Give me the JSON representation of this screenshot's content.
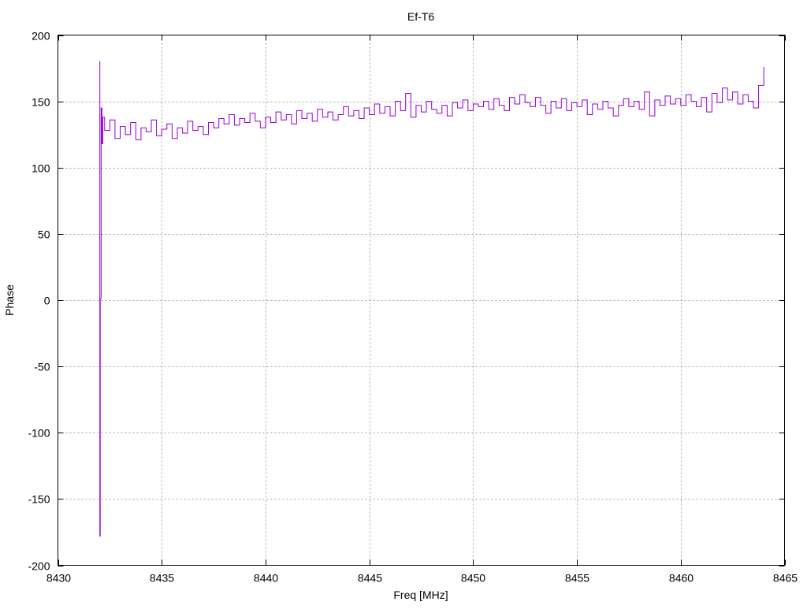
{
  "chart_data": {
    "type": "line",
    "title": "Ef-T6",
    "xlabel": "Freq [MHz]",
    "ylabel": "Phase",
    "xlim": [
      8430,
      8465
    ],
    "ylim": [
      -200,
      200
    ],
    "xticks": [
      8430,
      8435,
      8440,
      8445,
      8450,
      8455,
      8460,
      8465
    ],
    "yticks": [
      -200,
      -150,
      -100,
      -50,
      0,
      50,
      100,
      150,
      200
    ],
    "grid": true,
    "legend": "none",
    "series": [
      {
        "name": "Ef-T6",
        "color": "#9400d3",
        "style": "steps",
        "x": [
          8432.0,
          8432.02,
          8432.04,
          8432.08,
          8432.12,
          8432.16,
          8432.25,
          8432.5,
          8432.75,
          8433,
          8433.25,
          8433.5,
          8433.75,
          8434,
          8434.25,
          8434.5,
          8434.75,
          8435,
          8435.25,
          8435.5,
          8435.75,
          8436,
          8436.25,
          8436.5,
          8436.75,
          8437,
          8437.25,
          8437.5,
          8437.75,
          8438,
          8438.25,
          8438.5,
          8438.75,
          8439,
          8439.25,
          8439.5,
          8439.75,
          8440,
          8440.25,
          8440.5,
          8440.75,
          8441,
          8441.25,
          8441.5,
          8441.75,
          8442,
          8442.25,
          8442.5,
          8442.75,
          8443,
          8443.25,
          8443.5,
          8443.75,
          8444,
          8444.25,
          8444.5,
          8444.75,
          8445,
          8445.25,
          8445.5,
          8445.75,
          8446,
          8446.25,
          8446.5,
          8446.75,
          8447,
          8447.25,
          8447.5,
          8447.75,
          8448,
          8448.25,
          8448.5,
          8448.75,
          8449,
          8449.25,
          8449.5,
          8449.75,
          8450,
          8450.25,
          8450.5,
          8450.75,
          8451,
          8451.25,
          8451.5,
          8451.75,
          8452,
          8452.25,
          8452.5,
          8452.75,
          8453,
          8453.25,
          8453.5,
          8453.75,
          8454,
          8454.25,
          8454.5,
          8454.75,
          8455,
          8455.25,
          8455.5,
          8455.75,
          8456,
          8456.25,
          8456.5,
          8456.75,
          8457,
          8457.25,
          8457.5,
          8457.75,
          8458,
          8458.25,
          8458.5,
          8458.75,
          8459,
          8459.25,
          8459.5,
          8459.75,
          8460,
          8460.25,
          8460.5,
          8460.75,
          8461,
          8461.25,
          8461.5,
          8461.75,
          8462,
          8462.25,
          8462.5,
          8462.75,
          8463,
          8463.25,
          8463.5,
          8463.75,
          8464
        ],
        "y": [
          180,
          -178,
          1,
          145,
          118,
          138,
          128,
          136,
          122,
          131,
          125,
          134,
          121,
          130,
          127,
          136,
          124,
          129,
          133,
          122,
          130,
          126,
          135,
          128,
          131,
          125,
          134,
          130,
          137,
          133,
          140,
          132,
          137,
          134,
          141,
          135,
          130,
          138,
          134,
          142,
          136,
          140,
          133,
          143,
          137,
          141,
          135,
          144,
          138,
          142,
          136,
          140,
          146,
          139,
          143,
          137,
          145,
          140,
          148,
          141,
          146,
          139,
          150,
          143,
          156,
          138,
          147,
          142,
          150,
          144,
          141,
          147,
          139,
          149,
          145,
          151,
          143,
          148,
          146,
          150,
          144,
          152,
          147,
          143,
          153,
          148,
          155,
          149,
          146,
          153,
          147,
          141,
          150,
          145,
          152,
          143,
          149,
          146,
          151,
          140,
          148,
          144,
          150,
          145,
          139,
          147,
          152,
          146,
          150,
          144,
          157,
          139,
          151,
          147,
          154,
          148,
          152,
          147,
          155,
          150,
          146,
          153,
          142,
          156,
          149,
          160,
          151,
          157,
          148,
          155,
          150,
          145,
          162,
          176
        ]
      }
    ]
  }
}
